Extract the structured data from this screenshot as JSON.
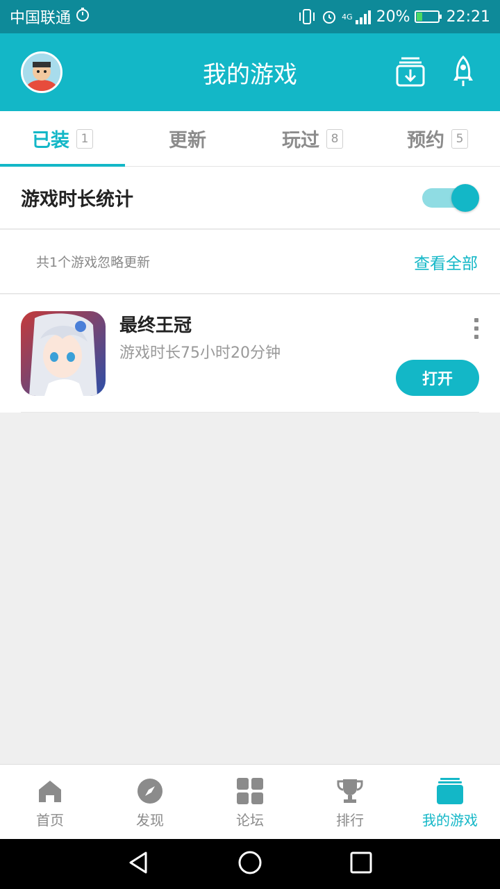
{
  "status_bar": {
    "carrier": "中国联通",
    "signal_type": "4G",
    "battery": "20%",
    "time": "22:21",
    "icons": [
      "stopwatch-icon",
      "vibrate-icon",
      "alarm-icon",
      "signal-icon",
      "battery-icon"
    ]
  },
  "header": {
    "title": "我的游戏",
    "icons": [
      "avatar",
      "download-manager-icon",
      "rocket-icon"
    ]
  },
  "tabs": [
    {
      "label": "已装",
      "count": "1",
      "active": true
    },
    {
      "label": "更新",
      "count": "",
      "active": false
    },
    {
      "label": "玩过",
      "count": "8",
      "active": false
    },
    {
      "label": "预约",
      "count": "5",
      "active": false
    }
  ],
  "stats": {
    "label": "游戏时长统计",
    "enabled": true
  },
  "ignored": {
    "text": "共1个游戏忽略更新",
    "view_all": "查看全部"
  },
  "games": [
    {
      "name": "最终王冠",
      "playtime": "游戏时长75小时20分钟",
      "action": "打开"
    }
  ],
  "bottom_nav": [
    {
      "label": "首页",
      "icon": "home-icon",
      "active": false
    },
    {
      "label": "发现",
      "icon": "compass-icon",
      "active": false
    },
    {
      "label": "论坛",
      "icon": "grid-icon",
      "active": false
    },
    {
      "label": "排行",
      "icon": "trophy-icon",
      "active": false
    },
    {
      "label": "我的游戏",
      "icon": "my-games-icon",
      "active": true
    }
  ],
  "colors": {
    "accent": "#13b7c7",
    "status_bar": "#0e8a99",
    "inactive": "#8b8b8b"
  }
}
